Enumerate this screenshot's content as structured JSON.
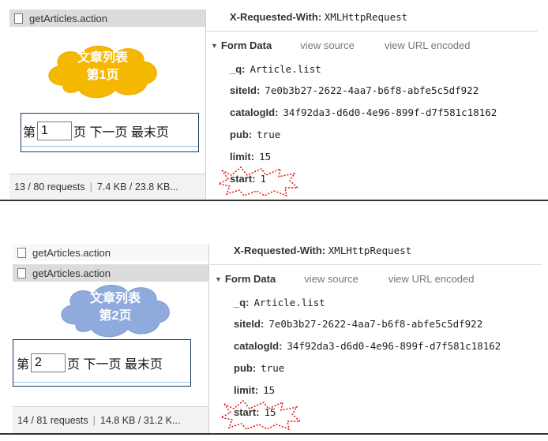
{
  "panels": [
    {
      "requests": [
        "getArticles.action"
      ],
      "cloud": {
        "line1": "文章列表",
        "line2": "第1页",
        "color": "#f5b800"
      },
      "pager": {
        "prefix": "第",
        "page": "1",
        "suffix": "页 下一页 最末页"
      },
      "status": {
        "requests": "13 / 80 requests",
        "size": "7.4 KB / 23.8 KB..."
      },
      "header": {
        "key": "X-Requested-With:",
        "value": "XMLHttpRequest"
      },
      "form": {
        "title": "Form Data",
        "view_source": "view source",
        "view_url": "view URL encoded"
      },
      "params": [
        {
          "key": "_q:",
          "value": "Article.list"
        },
        {
          "key": "siteId:",
          "value": "7e0b3b27-2622-4aa7-b6f8-abfe5c5df922"
        },
        {
          "key": "catalogId:",
          "value": "34f92da3-d6d0-4e96-899f-d7f581c18162"
        },
        {
          "key": "pub:",
          "value": "true"
        },
        {
          "key": "limit:",
          "value": "15"
        },
        {
          "key": "start:",
          "value": "1"
        }
      ]
    },
    {
      "requests": [
        "getArticles.action",
        "getArticles.action"
      ],
      "cloud": {
        "line1": "文章列表",
        "line2": "第2页",
        "color": "#8faadc"
      },
      "pager": {
        "prefix": "第",
        "page": "2",
        "suffix": "页 下一页 最末页"
      },
      "status": {
        "requests": "14 / 81 requests",
        "size": "14.8 KB / 31.2 K..."
      },
      "header": {
        "key": "X-Requested-With:",
        "value": "XMLHttpRequest"
      },
      "form": {
        "title": "Form Data",
        "view_source": "view source",
        "view_url": "view URL encoded"
      },
      "params": [
        {
          "key": "_q:",
          "value": "Article.list"
        },
        {
          "key": "siteId:",
          "value": "7e0b3b27-2622-4aa7-b6f8-abfe5c5df922"
        },
        {
          "key": "catalogId:",
          "value": "34f92da3-d6d0-4e96-899f-d7f581c18162"
        },
        {
          "key": "pub:",
          "value": "true"
        },
        {
          "key": "limit:",
          "value": "15"
        },
        {
          "key": "start:",
          "value": "15"
        }
      ]
    }
  ],
  "highlight_color": "#e00000"
}
